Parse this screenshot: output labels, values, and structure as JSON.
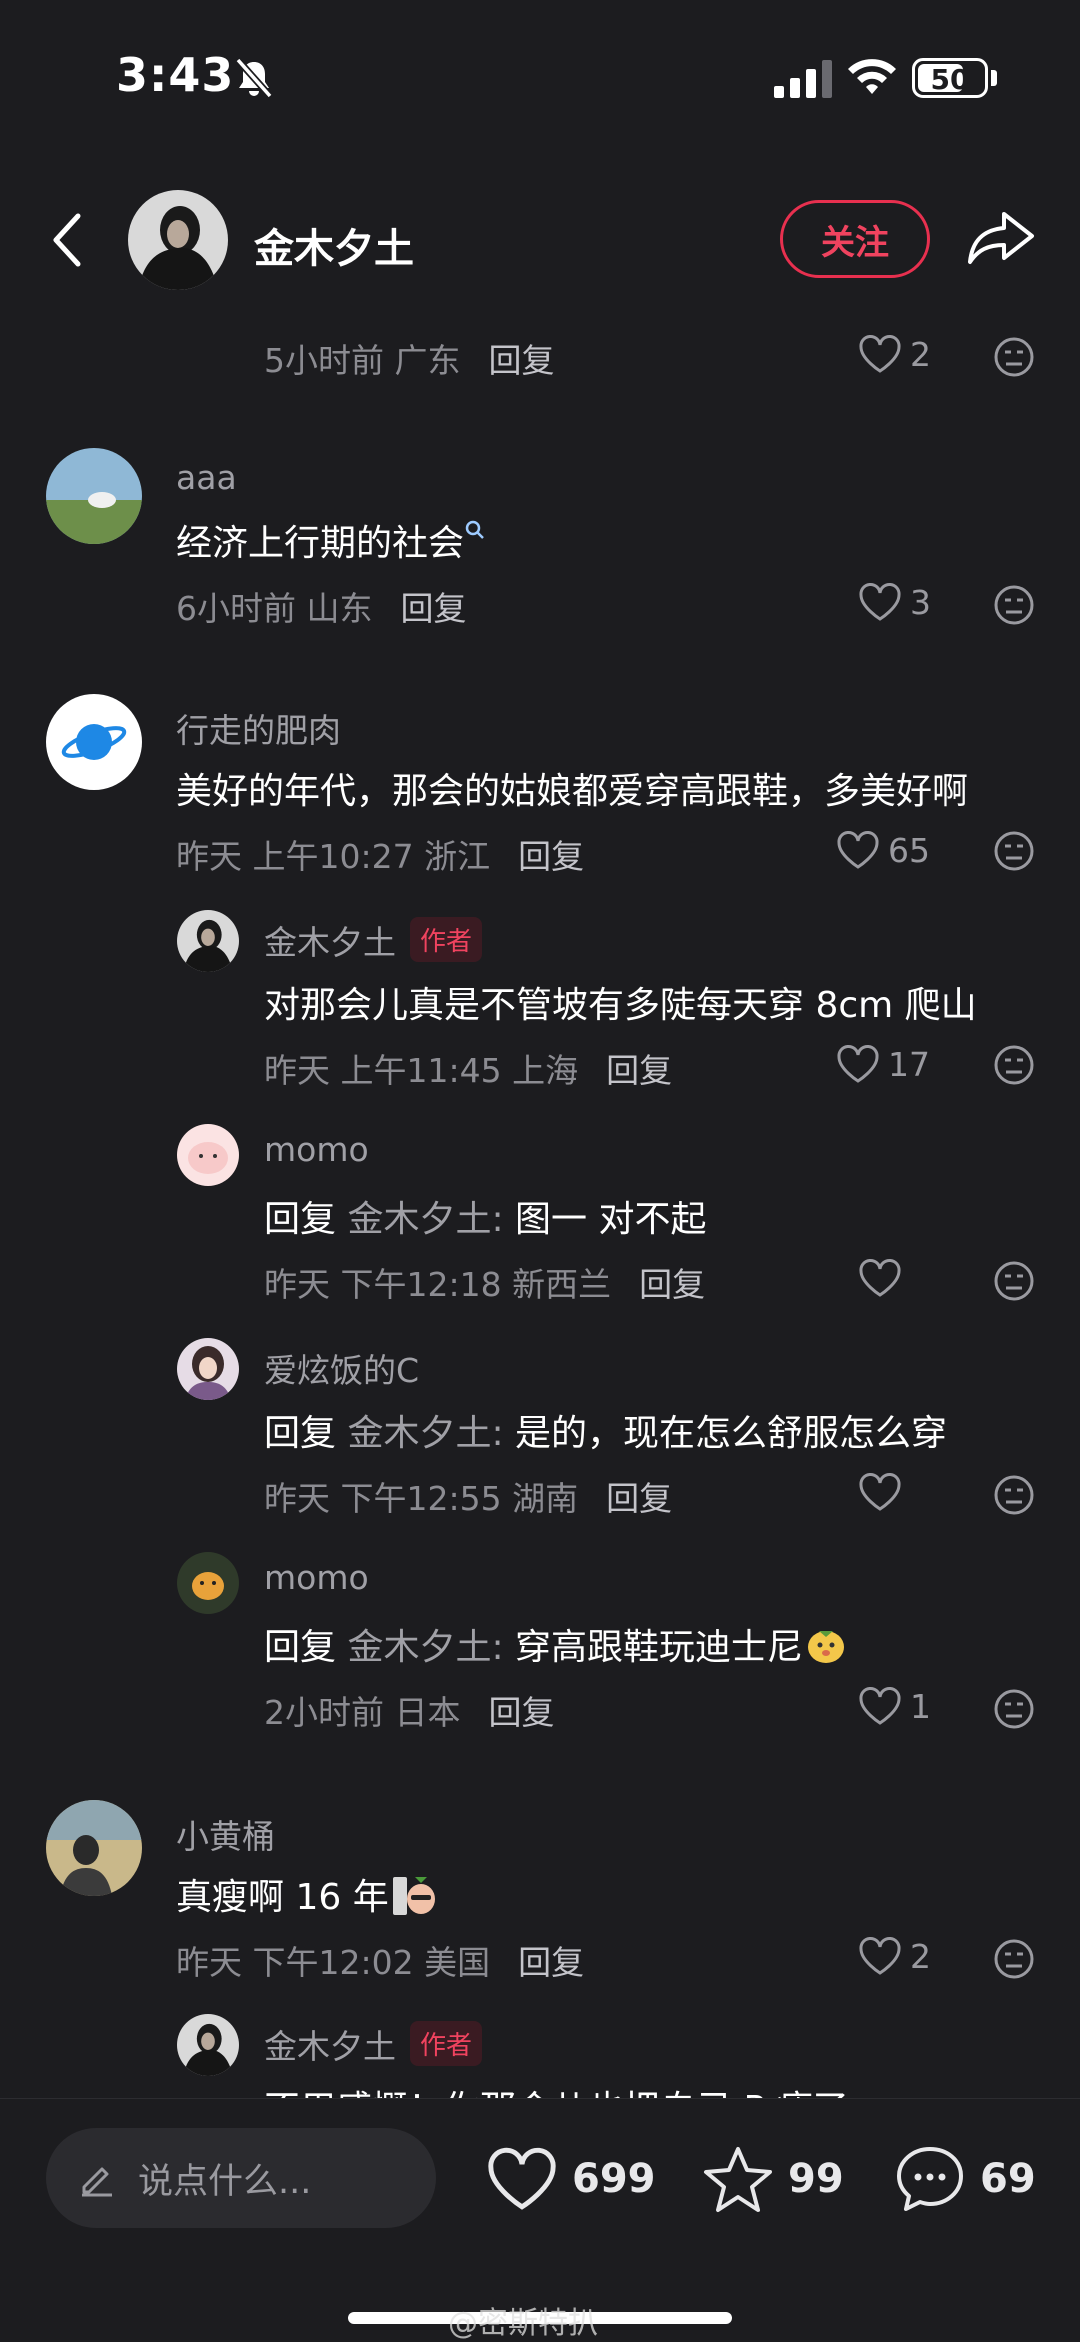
{
  "status_bar": {
    "time": "3:43",
    "battery": "50"
  },
  "header": {
    "username": "金木夕土",
    "follow_label": "关注"
  },
  "colors": {
    "background": "#1c1c1f",
    "accent": "#e8304f"
  },
  "comments": [
    {
      "meta": {
        "time": "5小时前",
        "location": "广东",
        "reply": "回复"
      },
      "likes": "2"
    },
    {
      "name": "aaa",
      "text": "经济上行期的社会",
      "search_hint": "search-icon",
      "meta": {
        "time": "6小时前",
        "location": "山东",
        "reply": "回复"
      },
      "likes": "3"
    },
    {
      "name": "行走的肥肉",
      "text": "美好的年代，那会的姑娘都爱穿高跟鞋，多美好啊",
      "meta": {
        "time": "昨天 上午10:27",
        "location": "浙江",
        "reply": "回复"
      },
      "likes": "65"
    },
    {
      "name": "金木夕土",
      "tag": "作者",
      "text": "对那会儿真是不管坡有多陡每天穿 8cm 爬山",
      "meta": {
        "time": "昨天 上午11:45",
        "location": "上海",
        "reply": "回复"
      },
      "likes": "17"
    },
    {
      "name": "momo",
      "reply_prefix": "回复",
      "reply_to": "金木夕土:",
      "text": " 图一 对不起",
      "meta": {
        "time": "昨天 下午12:18",
        "location": "新西兰",
        "reply": "回复"
      },
      "likes": ""
    },
    {
      "name": "爱炫饭的C",
      "reply_prefix": "回复",
      "reply_to": "金木夕土:",
      "text": " 是的，现在怎么舒服怎么穿",
      "meta": {
        "time": "昨天 下午12:55",
        "location": "湖南",
        "reply": "回复"
      },
      "likes": ""
    },
    {
      "name": "momo",
      "reply_prefix": "回复",
      "reply_to": "金木夕土:",
      "text": " 穿高跟鞋玩迪士尼",
      "meta": {
        "time": "2小时前",
        "location": "日本",
        "reply": "回复"
      },
      "likes": "1"
    },
    {
      "name": "小黄桶",
      "text": "真瘦啊 16 年",
      "meta": {
        "time": "昨天 下午12:02",
        "location": "美国",
        "reply": "回复"
      },
      "likes": "2"
    },
    {
      "name": "金木夕土",
      "tag": "作者",
      "text": "不用感慨！你那会儿也把自己 P 瘦了"
    }
  ],
  "bottom_bar": {
    "input_placeholder": "说点什么...",
    "likes": "699",
    "favorites": "99",
    "comments": "69"
  },
  "watermark": "@密斯特扒"
}
